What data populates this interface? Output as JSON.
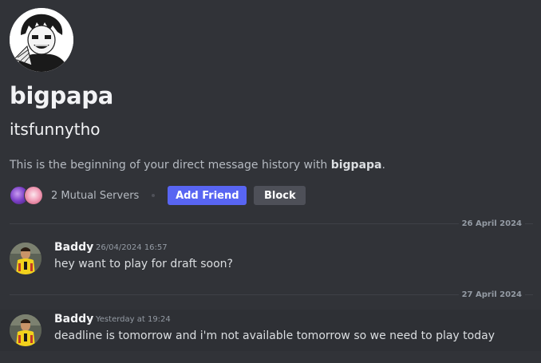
{
  "profile": {
    "display_name": "bigpapa",
    "username": "itsfunnytho",
    "intro_prefix": "This is the beginning of your direct message history with ",
    "intro_name": "bigpapa",
    "intro_suffix": ".",
    "mutual_servers_label": "2 Mutual Servers",
    "add_friend_label": "Add Friend",
    "block_label": "Block"
  },
  "dividers": [
    {
      "label": "26 April 2024"
    },
    {
      "label": "27 April 2024"
    }
  ],
  "messages": [
    {
      "author": "Baddy",
      "timestamp": "26/04/2024 16:57",
      "text": "hey want to play for draft soon?"
    },
    {
      "author": "Baddy",
      "timestamp": "Yesterday at 19:24",
      "text": "deadline is tomorrow and i'm not available tomorrow so we need to play today"
    }
  ],
  "colors": {
    "background": "#313338",
    "brand": "#5865f2",
    "secondary_button": "#4e5058",
    "hover_row": "#2e3035",
    "muted_text": "#949ba4"
  }
}
